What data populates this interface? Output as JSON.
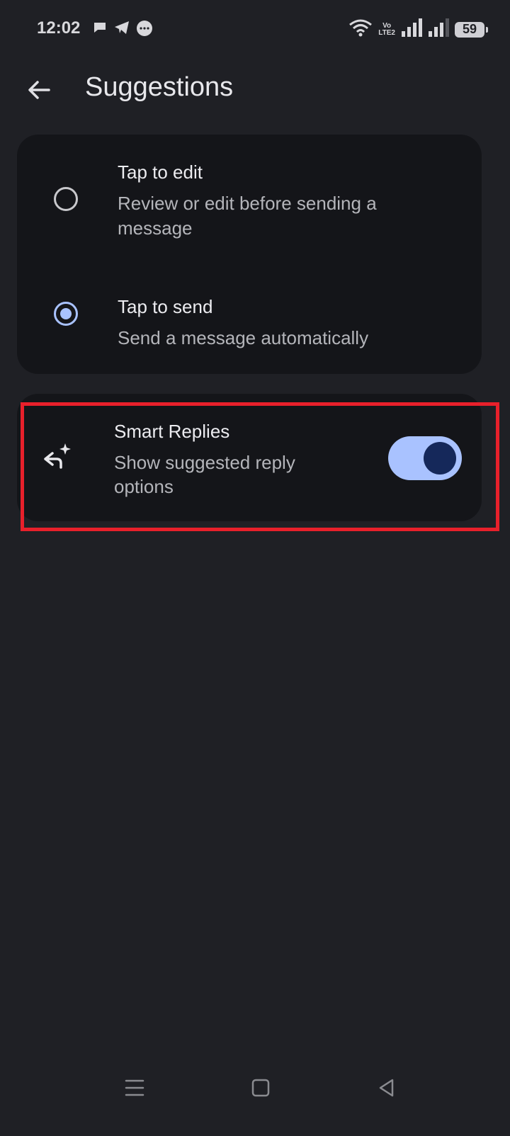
{
  "status_bar": {
    "time": "12:02",
    "network_label_top": "Vo",
    "network_label_bottom": "LTE2",
    "battery": "59"
  },
  "header": {
    "title": "Suggestions"
  },
  "suggestions_mode": {
    "options": [
      {
        "title": "Tap to edit",
        "subtitle": "Review or edit before sending a message",
        "selected": false
      },
      {
        "title": "Tap to send",
        "subtitle": "Send a message automatically",
        "selected": true
      }
    ]
  },
  "smart_replies": {
    "title": "Smart Replies",
    "subtitle": "Show suggested reply options",
    "enabled": true
  },
  "colors": {
    "background": "#1f2025",
    "card": "#141519",
    "accent": "#a9c2ff",
    "toggle_knob": "#15285a",
    "highlight": "#e8202b"
  }
}
